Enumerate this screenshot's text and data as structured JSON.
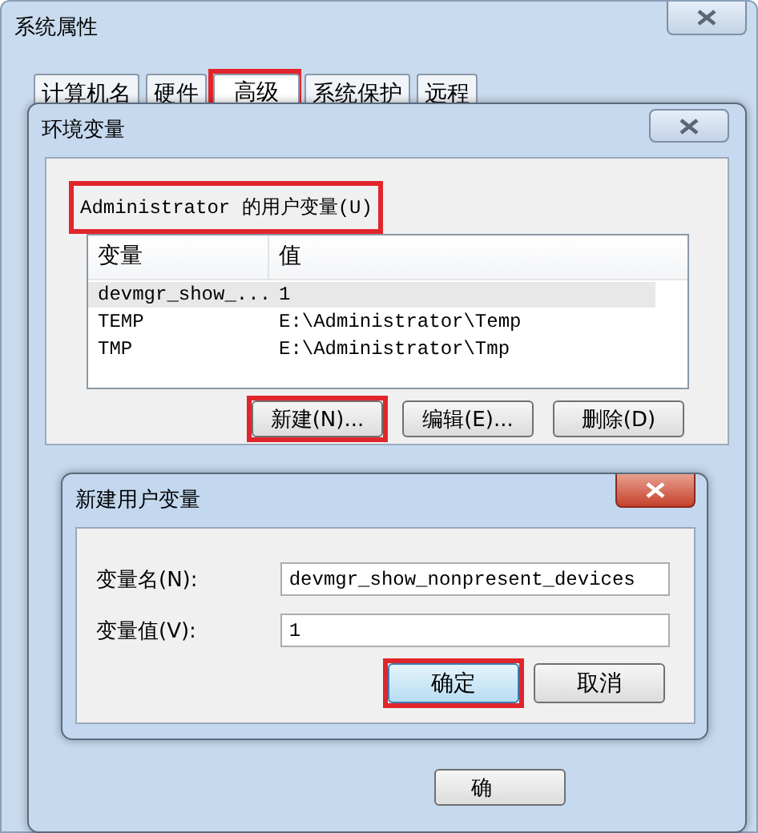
{
  "window": {
    "title": "系统属性"
  },
  "tabs": [
    {
      "label": "计算机名",
      "selected": false,
      "highlighted": false
    },
    {
      "label": "硬件",
      "selected": false,
      "highlighted": false
    },
    {
      "label": "高级",
      "selected": true,
      "highlighted": true
    },
    {
      "label": "系统保护",
      "selected": false,
      "highlighted": false
    },
    {
      "label": "远程",
      "selected": false,
      "highlighted": false
    }
  ],
  "env_dialog": {
    "title": "环境变量",
    "user_vars_label": "Administrator 的用户变量(U)",
    "label_highlighted": true,
    "columns": [
      "变量",
      "值"
    ],
    "rows": [
      {
        "name": "devmgr_show_...",
        "value": "1",
        "selected": true
      },
      {
        "name": "TEMP",
        "value": "E:\\Administrator\\Temp",
        "selected": false
      },
      {
        "name": "TMP",
        "value": "E:\\Administrator\\Tmp",
        "selected": false
      }
    ],
    "buttons": [
      {
        "label": "新建(N)...",
        "highlighted": true
      },
      {
        "label": "编辑(E)...",
        "highlighted": false
      },
      {
        "label": "删除(D)",
        "highlighted": false
      }
    ],
    "bottom_button": "确"
  },
  "new_var_dialog": {
    "title": "新建用户变量",
    "fields": [
      {
        "label": "变量名(N):",
        "value": "devmgr_show_nonpresent_devices"
      },
      {
        "label": "变量值(V):",
        "value": "1"
      }
    ],
    "buttons": [
      {
        "label": "确定",
        "highlighted": true,
        "default": true
      },
      {
        "label": "取消",
        "highlighted": false,
        "default": false
      }
    ]
  }
}
